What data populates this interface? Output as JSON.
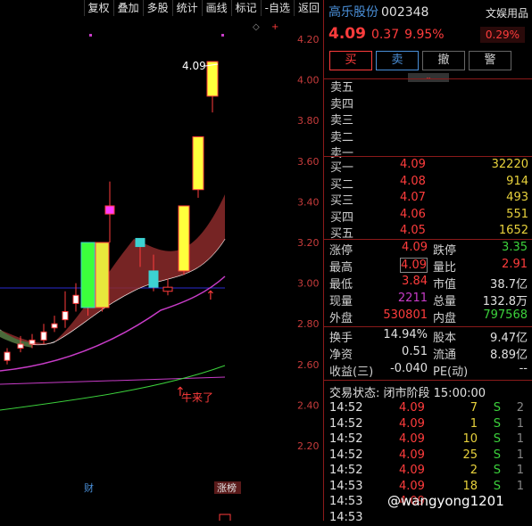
{
  "toolbar": {
    "items": [
      "复权",
      "叠加",
      "多股",
      "统计",
      "画线",
      "标记",
      "-自选",
      "返回"
    ]
  },
  "chart": {
    "price_labels": [
      "4.20",
      "4.00",
      "3.80",
      "3.60",
      "3.40",
      "3.20",
      "3.00",
      "2.80",
      "2.60",
      "2.40",
      "2.20"
    ],
    "last_price_tag": "4.09",
    "annotation": "牛来了",
    "bottom_labels": {
      "cai": "财",
      "zhangbang": "涨榜"
    }
  },
  "stock": {
    "name": "高乐股份",
    "code": "002348",
    "price": "4.09",
    "change": "0.37",
    "pct": "9.95%",
    "sector": "文娱用品",
    "sector_pct": "0.29%"
  },
  "actions": {
    "buy": "买",
    "sell": "卖",
    "cancel": "撤",
    "alert": "警"
  },
  "order_book": {
    "asks": [
      {
        "label": "卖五",
        "price": "",
        "vol": ""
      },
      {
        "label": "卖四",
        "price": "",
        "vol": ""
      },
      {
        "label": "卖三",
        "price": "",
        "vol": ""
      },
      {
        "label": "卖二",
        "price": "",
        "vol": ""
      },
      {
        "label": "卖一",
        "price": "",
        "vol": ""
      }
    ],
    "bids": [
      {
        "label": "买一",
        "price": "4.09",
        "vol": "32220"
      },
      {
        "label": "买二",
        "price": "4.08",
        "vol": "914"
      },
      {
        "label": "买三",
        "price": "4.07",
        "vol": "493"
      },
      {
        "label": "买四",
        "price": "4.06",
        "vol": "551"
      },
      {
        "label": "买五",
        "price": "4.05",
        "vol": "1652"
      }
    ]
  },
  "stats": [
    {
      "k1": "涨停",
      "v1": "4.09",
      "c1": "#ff3c3c",
      "k2": "跌停",
      "v2": "3.35",
      "c2": "#3cd23c"
    },
    {
      "k1": "最高",
      "v1": "4.09",
      "c1": "#ff3c3c",
      "k2": "量比",
      "v2": "2.91",
      "c2": "#ff3c3c"
    },
    {
      "k1": "最低",
      "v1": "3.84",
      "c1": "#ff3c3c",
      "k2": "市值",
      "v2": "38.7亿",
      "c2": "#e0e0e0"
    },
    {
      "k1": "现量",
      "v1": "2211",
      "c1": "#c83cc8",
      "k2": "总量",
      "v2": "132.8万",
      "c2": "#e0e0e0"
    },
    {
      "k1": "外盘",
      "v1": "530801",
      "c1": "#ff3c3c",
      "k2": "内盘",
      "v2": "797568",
      "c2": "#3cd23c"
    }
  ],
  "stats2": [
    {
      "k1": "换手",
      "v1": "14.94%",
      "k2": "股本",
      "v2": "9.47亿"
    },
    {
      "k1": "净资",
      "v1": "0.51",
      "k2": "流通",
      "v2": "8.89亿"
    },
    {
      "k1": "收益(三)",
      "v1": "-0.040",
      "k2": "PE(动)",
      "v2": "--"
    }
  ],
  "trade_status": "交易状态: 闭市阶段 15:00:00",
  "trades": [
    {
      "t": "14:52",
      "p": "4.09",
      "v": "7",
      "s": "S",
      "n": "2"
    },
    {
      "t": "14:52",
      "p": "4.09",
      "v": "1",
      "s": "S",
      "n": "1"
    },
    {
      "t": "14:52",
      "p": "4.09",
      "v": "10",
      "s": "S",
      "n": "1"
    },
    {
      "t": "14:52",
      "p": "4.09",
      "v": "25",
      "s": "S",
      "n": "1"
    },
    {
      "t": "14:52",
      "p": "4.09",
      "v": "2",
      "s": "S",
      "n": "1"
    },
    {
      "t": "14:53",
      "p": "4.09",
      "v": "18",
      "s": "S",
      "n": "1"
    },
    {
      "t": "14:53",
      "p": "4.09",
      "v": "",
      "s": "",
      "n": ""
    },
    {
      "t": "14:53",
      "p": "",
      "v": "",
      "s": "",
      "n": ""
    }
  ],
  "watermark": "@wangyong1201",
  "chart_data": {
    "type": "candlestick",
    "ylim": [
      2.15,
      4.25
    ],
    "candles": [
      {
        "o": 2.62,
        "c": 2.66,
        "h": 2.68,
        "l": 2.6
      },
      {
        "o": 2.68,
        "c": 2.7,
        "h": 2.74,
        "l": 2.66
      },
      {
        "o": 2.7,
        "c": 2.72,
        "h": 2.75,
        "l": 2.68
      },
      {
        "o": 2.72,
        "c": 2.76,
        "h": 2.8,
        "l": 2.7
      },
      {
        "o": 2.78,
        "c": 2.8,
        "h": 2.84,
        "l": 2.76
      },
      {
        "o": 2.82,
        "c": 2.86,
        "h": 2.96,
        "l": 2.78
      },
      {
        "o": 2.9,
        "c": 2.94,
        "h": 3.0,
        "l": 2.86
      },
      {
        "o": 3.2,
        "c": 2.88,
        "h": 3.2,
        "l": 2.84
      },
      {
        "o": 2.88,
        "c": 3.2,
        "h": 3.2,
        "l": 2.86
      },
      {
        "o": 3.34,
        "c": 3.38,
        "h": 3.5,
        "l": 3.2
      },
      {
        "o": 3.22,
        "c": 3.18,
        "h": 3.22,
        "l": 3.08
      },
      {
        "o": 3.06,
        "c": 2.98,
        "h": 3.14,
        "l": 2.96
      },
      {
        "o": 2.96,
        "c": 2.98,
        "h": 3.02,
        "l": 2.94
      },
      {
        "o": 3.06,
        "c": 3.38,
        "h": 3.38,
        "l": 3.04
      },
      {
        "o": 3.46,
        "c": 3.72,
        "h": 3.72,
        "l": 3.42
      },
      {
        "o": 3.92,
        "c": 4.09,
        "h": 4.09,
        "l": 3.84
      }
    ]
  }
}
